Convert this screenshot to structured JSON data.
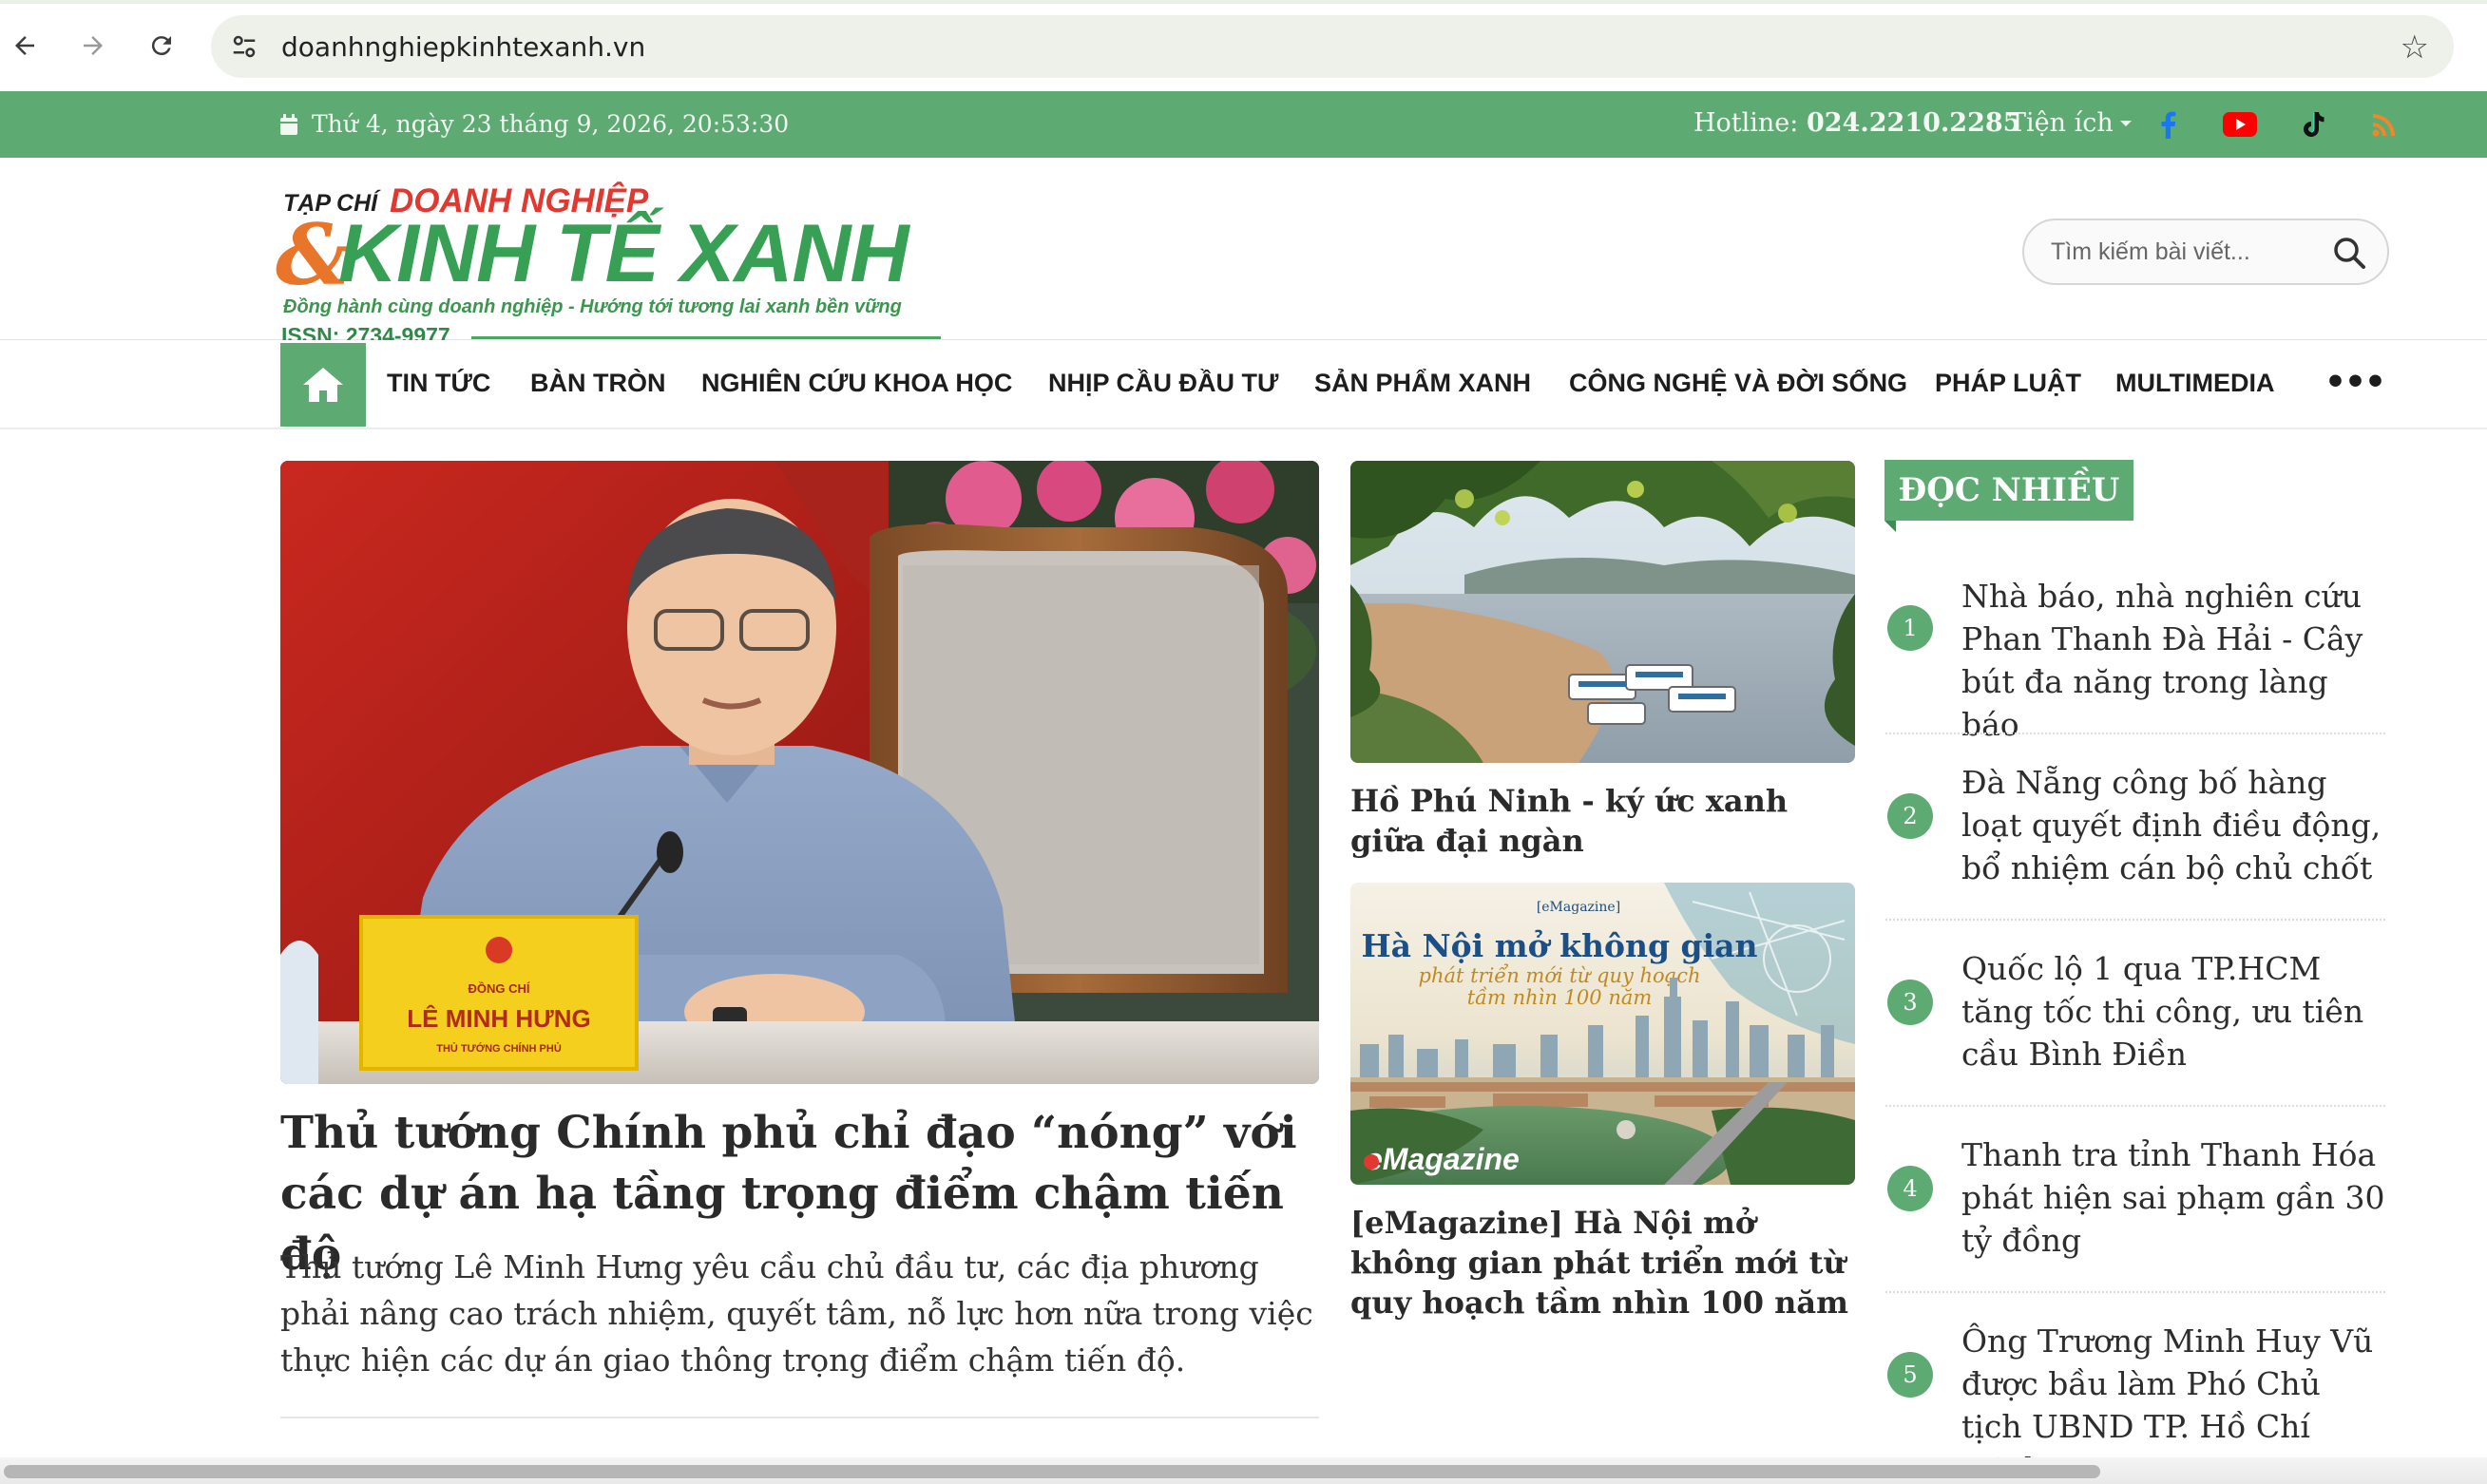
{
  "browser": {
    "url": "doanhnghiepkinhtexanh.vn",
    "back_icon": "arrow-left",
    "forward_icon": "arrow-right",
    "reload_icon": "reload",
    "site_info_icon": "tune",
    "bookmark_icon": "star-outline"
  },
  "topbar": {
    "date": "Thứ 4, ngày 23 tháng 9, 2026, 20:53:30",
    "hotline_label": "Hotline:",
    "hotline_number": "024.2210.2285",
    "utilities_label": "Tiện ích",
    "social": [
      "facebook",
      "youtube",
      "tiktok",
      "rss"
    ]
  },
  "logo": {
    "tapchi": "TẠP CHÍ",
    "name_top": "DOANH NGHIỆP",
    "ampersand": "&",
    "name_main": "KINH TẾ XANH",
    "slogan": "Đồng hành cùng doanh nghiệp - Hướng tới tương lai xanh bền vững",
    "issn": "ISSN: 2734-9977"
  },
  "search": {
    "placeholder": "Tìm kiếm bài viết..."
  },
  "menu": {
    "items": [
      "TIN TỨC",
      "BÀN TRÒN",
      "NGHIÊN CỨU KHOA HỌC",
      "NHỊP CẦU ĐẦU TƯ",
      "SẢN PHẨM XANH",
      "CÔNG NGHỆ VÀ ĐỜI SỐNG",
      "PHÁP LUẬT",
      "MULTIMEDIA"
    ],
    "more": "•••"
  },
  "lead": {
    "nameplate_title": "ĐỒNG CHÍ",
    "nameplate_name": "LÊ MINH HƯNG",
    "nameplate_role": "THỦ TƯỚNG CHÍNH PHỦ",
    "title": "Thủ tướng Chính phủ chỉ đạo “nóng” với các dự án hạ tầng trọng điểm chậm tiến độ",
    "sapo": "Thủ tướng Lê Minh Hưng yêu cầu chủ đầu tư, các địa phương phải nâng cao trách nhiệm, quyết tâm, nỗ lực hơn nữa trong việc thực hiện các dự án giao thông trọng điểm chậm tiến độ."
  },
  "side": [
    {
      "title": "Hồ Phú Ninh - ký ức xanh giữa đại ngàn"
    },
    {
      "title": "[eMagazine] Hà Nội mở không gian phát triển mới từ quy hoạch tầm nhìn 100 năm",
      "img_tag": "[eMagazine]",
      "img_head": "Hà Nội mở không gian",
      "img_sub1": "phát triển mới từ quy hoạch",
      "img_sub2": "tầm nhìn 100 năm",
      "img_badge": "eMagazine"
    }
  ],
  "most_read": {
    "heading": "ĐỌC NHIỀU",
    "items": [
      {
        "num": "1",
        "title": "Nhà báo, nhà nghiên cứu Phan Thanh Đà Hải - Cây bút đa năng trong làng báo"
      },
      {
        "num": "2",
        "title": "Đà Nẵng công bố hàng loạt quyết định điều động, bổ nhiệm cán bộ chủ chốt"
      },
      {
        "num": "3",
        "title": "Quốc lộ 1 qua TP.HCM tăng tốc thi công, ưu tiên cầu Bình Điền"
      },
      {
        "num": "4",
        "title": "Thanh tra tỉnh Thanh Hóa phát hiện sai phạm gần 30 tỷ đồng"
      },
      {
        "num": "5",
        "title": "Ông Trương Minh Huy Vũ được bầu làm Phó Chủ tịch UBND TP. Hồ Chí Minh"
      }
    ]
  },
  "colors": {
    "brand_green": "#5dab73",
    "logo_red": "#e2382f",
    "logo_orange": "#e8752a",
    "logo_green": "#38a055"
  }
}
